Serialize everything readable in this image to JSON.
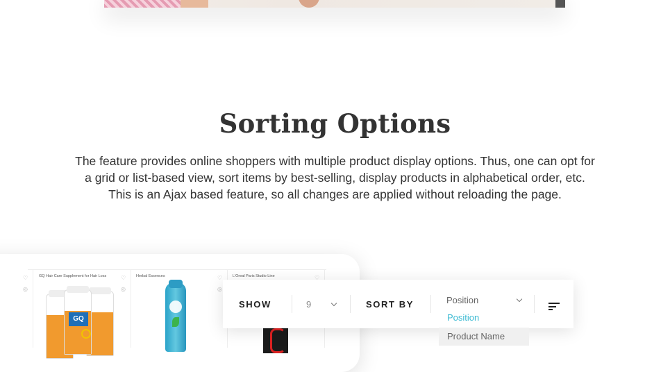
{
  "section": {
    "title": "Sorting Options",
    "description_lines": [
      "The feature provides online shoppers with multiple product display options. Thus, one can opt for",
      "a grid or list-based view, sort items by best-selling, display products in alphabetical order, etc.",
      "This is an Ajax based feature, so all changes are applied without reloading the page."
    ]
  },
  "products": [
    {
      "name": "GQ Hair Care Supplement for Hair Loss",
      "brand_text": "GQ"
    },
    {
      "name": "Herbal Essences"
    },
    {
      "name": "L'Oreal Paris Studio Line"
    }
  ],
  "toolbar": {
    "show_label": "SHOW",
    "show_value": "9",
    "sort_label": "SORT BY",
    "sort_value": "Position",
    "sort_options": [
      "Position",
      "Product Name"
    ]
  },
  "colors": {
    "accent": "#3dbbd3",
    "text": "#333333",
    "muted": "#888888"
  },
  "icons": [
    "heart-icon",
    "eye-icon",
    "chevron-down-icon",
    "sort-direction-icon"
  ]
}
